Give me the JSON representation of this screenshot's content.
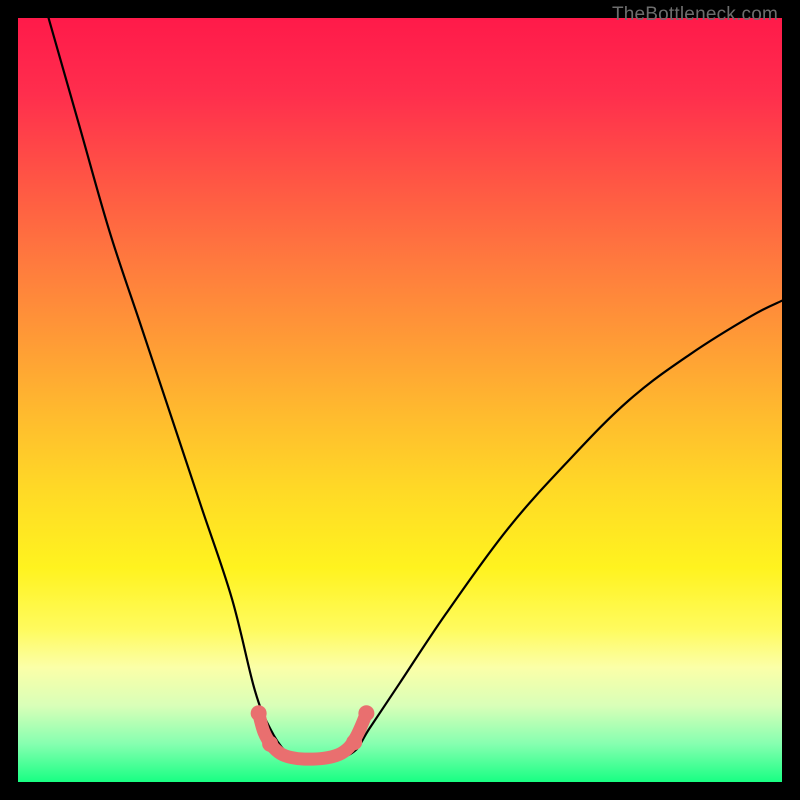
{
  "watermark": "TheBottleneck.com",
  "chart_data": {
    "type": "line",
    "title": "",
    "xlabel": "",
    "ylabel": "",
    "xlim": [
      0,
      100
    ],
    "ylim": [
      0,
      100
    ],
    "series": [
      {
        "name": "curve",
        "x": [
          4,
          8,
          12,
          16,
          20,
          24,
          28,
          31,
          33,
          35,
          37,
          41,
          44,
          46,
          50,
          56,
          64,
          72,
          80,
          88,
          96,
          100
        ],
        "y": [
          100,
          86,
          72,
          60,
          48,
          36,
          24,
          12,
          7,
          4,
          3,
          3,
          4,
          7,
          13,
          22,
          33,
          42,
          50,
          56,
          61,
          63
        ]
      },
      {
        "name": "trough-highlight",
        "x": [
          31.5,
          32.2,
          33.2,
          34.4,
          35.8,
          37.5,
          40.0,
          42.0,
          43.3,
          44.2,
          45.0,
          45.6
        ],
        "y": [
          9.0,
          6.5,
          4.8,
          3.7,
          3.2,
          3.0,
          3.1,
          3.6,
          4.5,
          5.8,
          7.5,
          9.0
        ]
      }
    ],
    "trough_markers": [
      {
        "x": 31.5,
        "y": 9.0
      },
      {
        "x": 33.0,
        "y": 5.0
      },
      {
        "x": 45.6,
        "y": 9.0
      },
      {
        "x": 44.0,
        "y": 5.2
      }
    ],
    "background_gradient": {
      "top": "#ff1a4a",
      "middle": "#ffda26",
      "bottom": "#18ff83"
    }
  }
}
